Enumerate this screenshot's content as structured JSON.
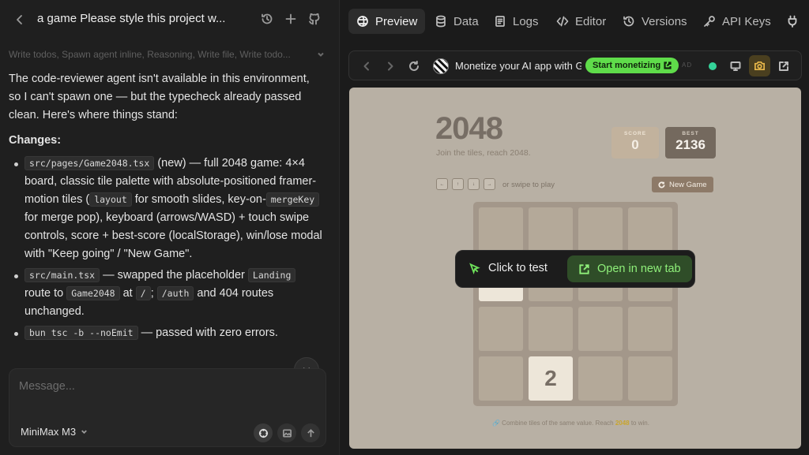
{
  "chat": {
    "title": "a game Please style this project w...",
    "tools_summary": "Write todos, Spawn agent inline, Reasoning, Write file, Write todo...",
    "intro": "The code-reviewer agent isn't available in this environment, so I can't spawn one — but the typecheck already passed clean. Here's where things stand:",
    "changes_heading": "Changes:",
    "bullets": [
      {
        "code1": "src/pages/Game2048.tsx",
        "t1": " (new) — full 2048 game: 4×4 board, classic tile palette with absolute-positioned framer-motion tiles (",
        "code2": "layout",
        "t2": " for smooth slides, key-on-",
        "code3": "mergeKey",
        "t3": " for merge pop), keyboard (arrows/WASD) + touch swipe controls, score + best-score (localStorage), win/lose modal with \"Keep going\" / \"New Game\"."
      },
      {
        "code1": "src/main.tsx",
        "t1": " — swapped the placeholder ",
        "code2": "Landing",
        "t2": " route to ",
        "code3": "Game2048",
        "t3": " at ",
        "code4": "/",
        "t4": "; ",
        "code5": "/auth",
        "t5": " and 404 routes unchanged."
      },
      {
        "code1": "bun tsc -b --noEmit",
        "t1": " — passed with zero errors."
      }
    ]
  },
  "composer": {
    "placeholder": "Message...",
    "model": "MiniMax M3"
  },
  "tabs": [
    {
      "label": "Preview",
      "icon": "preview-icon",
      "active": true
    },
    {
      "label": "Data",
      "icon": "database-icon"
    },
    {
      "label": "Logs",
      "icon": "logs-icon"
    },
    {
      "label": "Editor",
      "icon": "code-icon"
    },
    {
      "label": "Versions",
      "icon": "history-icon"
    },
    {
      "label": "API Keys",
      "icon": "key-icon"
    }
  ],
  "browser": {
    "promo_text": "Monetize your AI app with G...",
    "monetize_label": "Start monetizing",
    "ad_label": "AD",
    "status_color": "#34d399"
  },
  "game": {
    "title": "2048",
    "subtitle": "Join the tiles, reach 2048.",
    "score_label": "SCORE",
    "score": "0",
    "best_label": "BEST",
    "best": "2136",
    "keys": [
      "←",
      "↑",
      "↓",
      "→"
    ],
    "swipe_hint": "or swipe to play",
    "new_game_label": "New Game",
    "board": [
      [
        "",
        "",
        "",
        ""
      ],
      [
        "2",
        "",
        "",
        ""
      ],
      [
        "",
        "",
        "",
        ""
      ],
      [
        "",
        "2",
        "",
        ""
      ]
    ],
    "footer_prefix": "🔗 Combine tiles of the same value. Reach ",
    "footer_target": "2048",
    "footer_suffix": " to win."
  },
  "overlay": {
    "click_to_test": "Click to test",
    "open_new_tab": "Open in new tab"
  }
}
